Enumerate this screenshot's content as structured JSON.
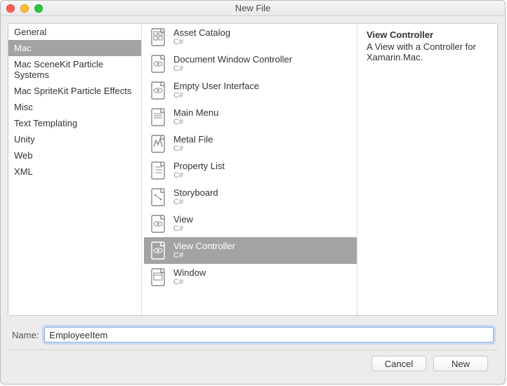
{
  "window": {
    "title": "New File"
  },
  "categories": [
    {
      "label": "General",
      "selected": false
    },
    {
      "label": "Mac",
      "selected": true
    },
    {
      "label": "Mac SceneKit Particle Systems",
      "selected": false
    },
    {
      "label": "Mac SpriteKit Particle Effects",
      "selected": false
    },
    {
      "label": "Misc",
      "selected": false
    },
    {
      "label": "Text Templating",
      "selected": false
    },
    {
      "label": "Unity",
      "selected": false
    },
    {
      "label": "Web",
      "selected": false
    },
    {
      "label": "XML",
      "selected": false
    }
  ],
  "templates": [
    {
      "name": "Asset Catalog",
      "sub": "C#",
      "icon": "grid",
      "selected": false
    },
    {
      "name": "Document Window Controller",
      "sub": "C#",
      "icon": "eye",
      "selected": false
    },
    {
      "name": "Empty User Interface",
      "sub": "C#",
      "icon": "eye",
      "selected": false
    },
    {
      "name": "Main Menu",
      "sub": "C#",
      "icon": "doc",
      "selected": false
    },
    {
      "name": "Metal File",
      "sub": "C#",
      "icon": "metal",
      "selected": false
    },
    {
      "name": "Property List",
      "sub": "C#",
      "icon": "list",
      "selected": false
    },
    {
      "name": "Storyboard",
      "sub": "C#",
      "icon": "story",
      "selected": false
    },
    {
      "name": "View",
      "sub": "C#",
      "icon": "eye",
      "selected": false
    },
    {
      "name": "View Controller",
      "sub": "C#",
      "icon": "eye",
      "selected": true
    },
    {
      "name": "Window",
      "sub": "C#",
      "icon": "window",
      "selected": false
    }
  ],
  "description": {
    "title": "View Controller",
    "body": "A View with a Controller for Xamarin.Mac."
  },
  "name_field": {
    "label": "Name:",
    "value": "EmployeeItem"
  },
  "buttons": {
    "cancel": "Cancel",
    "submit": "New"
  }
}
